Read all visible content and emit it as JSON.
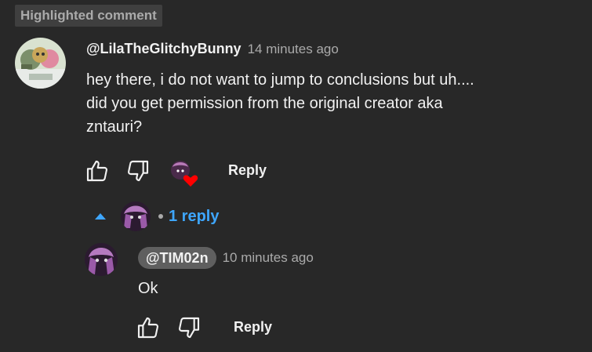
{
  "highlight_badge": "Highlighted comment",
  "comment": {
    "author": "@LilaTheGlitchyBunny",
    "time": "14 minutes ago",
    "text_lines": [
      "hey there, i do not want to jump to conclusions but uh....",
      "did you get permission from the original creator aka",
      "zntauri?"
    ],
    "avatar_icon": "creator-avatar",
    "like_icon": "thumb-up-icon",
    "dislike_icon": "thumb-down-icon",
    "heart_icon": "creator-heart-icon",
    "heart_color": "#ff0000",
    "reply_label": "Reply"
  },
  "replies_toggle": {
    "label": "1 reply",
    "icon": "chevron-up-icon",
    "color": "#3ea6ff"
  },
  "reply": {
    "author": "@TIM02n",
    "time": "10 minutes ago",
    "text": "Ok",
    "reply_label": "Reply"
  }
}
